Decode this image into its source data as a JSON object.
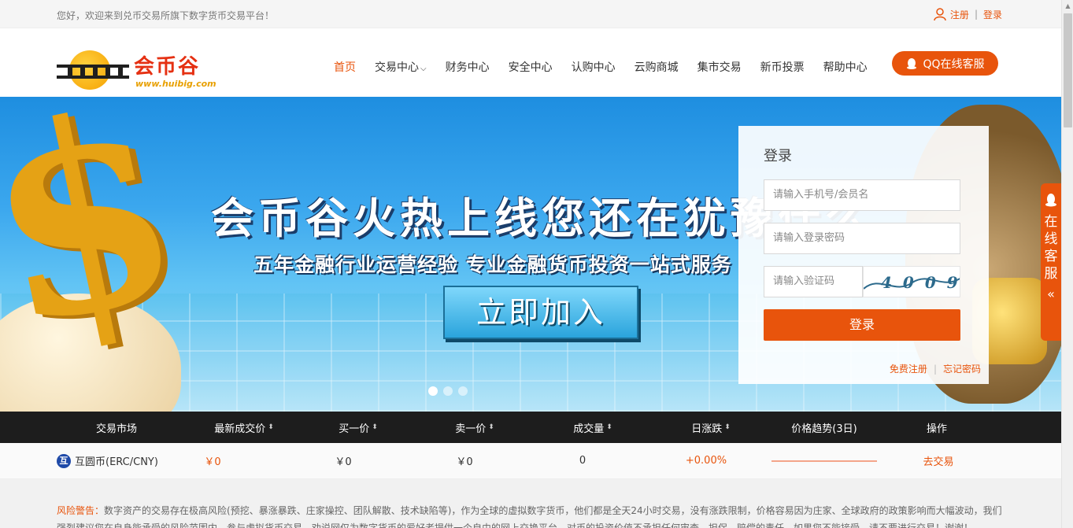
{
  "topbar": {
    "welcome": "您好，欢迎来到兑币交易所旗下数字货币交易平台！",
    "register": "注册",
    "login": "登录"
  },
  "header": {
    "logo_text": "会币谷",
    "logo_url": "www.huibig.com",
    "nav": [
      {
        "label": "首页",
        "active": true
      },
      {
        "label": "交易中心",
        "dropdown": true
      },
      {
        "label": "财务中心"
      },
      {
        "label": "安全中心"
      },
      {
        "label": "认购中心"
      },
      {
        "label": "云购商城"
      },
      {
        "label": "集市交易"
      },
      {
        "label": "新币投票"
      },
      {
        "label": "帮助中心"
      }
    ],
    "qq_button": "QQ在线客服"
  },
  "banner": {
    "headline": "会币谷火热上线您还在犹豫什么",
    "subline": "五年金融行业运营经验 专业金融货币投资一站式服务",
    "join_button": "立即加入",
    "slides": 3,
    "active_slide": 0
  },
  "login_panel": {
    "title": "登录",
    "username_placeholder": "请输入手机号/会员名",
    "password_placeholder": "请输入登录密码",
    "captcha_placeholder": "请输入验证码",
    "captcha_text": "4009",
    "submit": "登录",
    "register_link": "免费注册",
    "forgot_link": "忘记密码"
  },
  "side_tab": {
    "label": "在线客服",
    "collapse": "«"
  },
  "market": {
    "columns": [
      {
        "label": "交易市场",
        "sortable": false
      },
      {
        "label": "最新成交价",
        "sortable": true
      },
      {
        "label": "买一价",
        "sortable": true
      },
      {
        "label": "卖一价",
        "sortable": true
      },
      {
        "label": "成交量",
        "sortable": true
      },
      {
        "label": "日涨跌",
        "sortable": true
      },
      {
        "label": "价格趋势(3日)",
        "sortable": false
      },
      {
        "label": "操作",
        "sortable": false
      }
    ],
    "rows": [
      {
        "badge": "互",
        "market": "互圆币(ERC/CNY)",
        "last_price": "￥0",
        "bid": "￥0",
        "ask": "￥0",
        "volume": "0",
        "change": "+0.00%",
        "action": "去交易"
      }
    ]
  },
  "risk_notice": {
    "label": "风险警告：",
    "text": "数字资产的交易存在极高风险(预挖、暴涨暴跌、庄家操控、团队解散、技术缺陷等)，作为全球的虚拟数字货币，他们都是全天24小时交易，没有涨跌限制，价格容易因为庄家、全球政府的政策影响而大幅波动，我们强烈建议您在自身能承受的风险范围内，参与虚拟货币交易，劝说网仅为数字货币的爱好者提供一个自由的网上交换平台，对币的投资价值不承担任何审查、担保、赔偿的责任，如果您不能接受，请不要进行交易！谢谢！"
  },
  "colors": {
    "accent": "#e8540c",
    "table_header": "#1d1d1d"
  }
}
